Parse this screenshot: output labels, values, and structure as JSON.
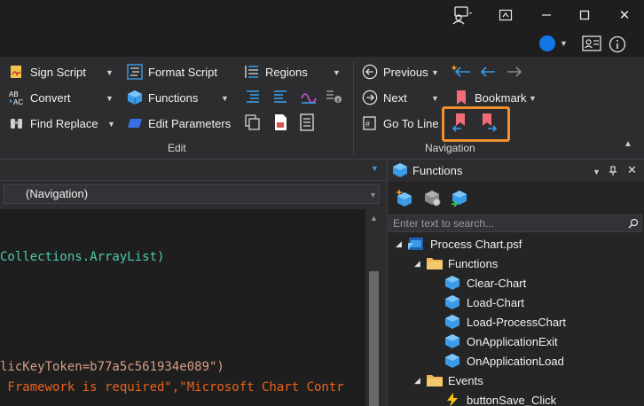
{
  "titlebar": {
    "feedback_icon": "feedback-person-icon",
    "restore_icon": "restore-down-icon",
    "minimize_icon": "minimize-icon",
    "maximize_icon": "maximize-icon",
    "close_label": "✕"
  },
  "account": {
    "contact_card_icon": "contact-card-icon",
    "info_icon": "info-icon",
    "accent": "#1177e8"
  },
  "ribbon": {
    "edit": {
      "sign_script": "Sign Script",
      "convert": "Convert",
      "find_replace": "Find Replace",
      "format_script": "Format Script",
      "functions": "Functions",
      "edit_parameters": "Edit Parameters",
      "regions": "Regions",
      "group_label": "Edit"
    },
    "navigation": {
      "previous": "Previous",
      "next": "Next",
      "go_to_line": "Go To Line",
      "bookmark": "Bookmark",
      "group_label": "Navigation"
    },
    "highlight_color": "#f0912e"
  },
  "editor": {
    "nav_combo": "(Navigation)",
    "lines": [
      {
        "text": "Collections.ArrayList)",
        "color": "#4ec9b0"
      },
      {
        "text": "licKeyToken=b77a5c561934e089\")",
        "color": "#d69d85"
      },
      {
        "text": " Framework is required\",\"Microsoft Chart Contr",
        "color": "#e8631c"
      }
    ]
  },
  "functions_panel": {
    "title": "Functions",
    "search_placeholder": "Enter text to search...",
    "tree": {
      "root": "Process Chart.psf",
      "folders": [
        {
          "label": "Functions",
          "items": [
            "Clear-Chart",
            "Load-Chart",
            "Load-ProcessChart",
            "OnApplicationExit",
            "OnApplicationLoad"
          ]
        },
        {
          "label": "Events",
          "items": [
            "buttonSave_Click"
          ]
        }
      ]
    }
  }
}
